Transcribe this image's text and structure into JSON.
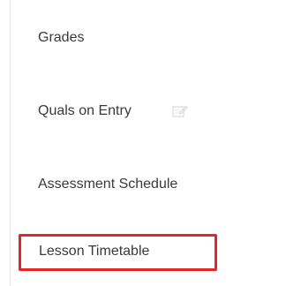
{
  "sidebar": {
    "items": [
      {
        "label": "Grades"
      },
      {
        "label": "Quals on Entry",
        "icon": "edit-icon"
      },
      {
        "label": "Assessment Schedule"
      },
      {
        "label": "Lesson Timetable",
        "highlighted": true
      }
    ]
  },
  "colors": {
    "highlight": "#e52629",
    "text": "#3a3a3a",
    "divider": "#e7e7e7"
  }
}
